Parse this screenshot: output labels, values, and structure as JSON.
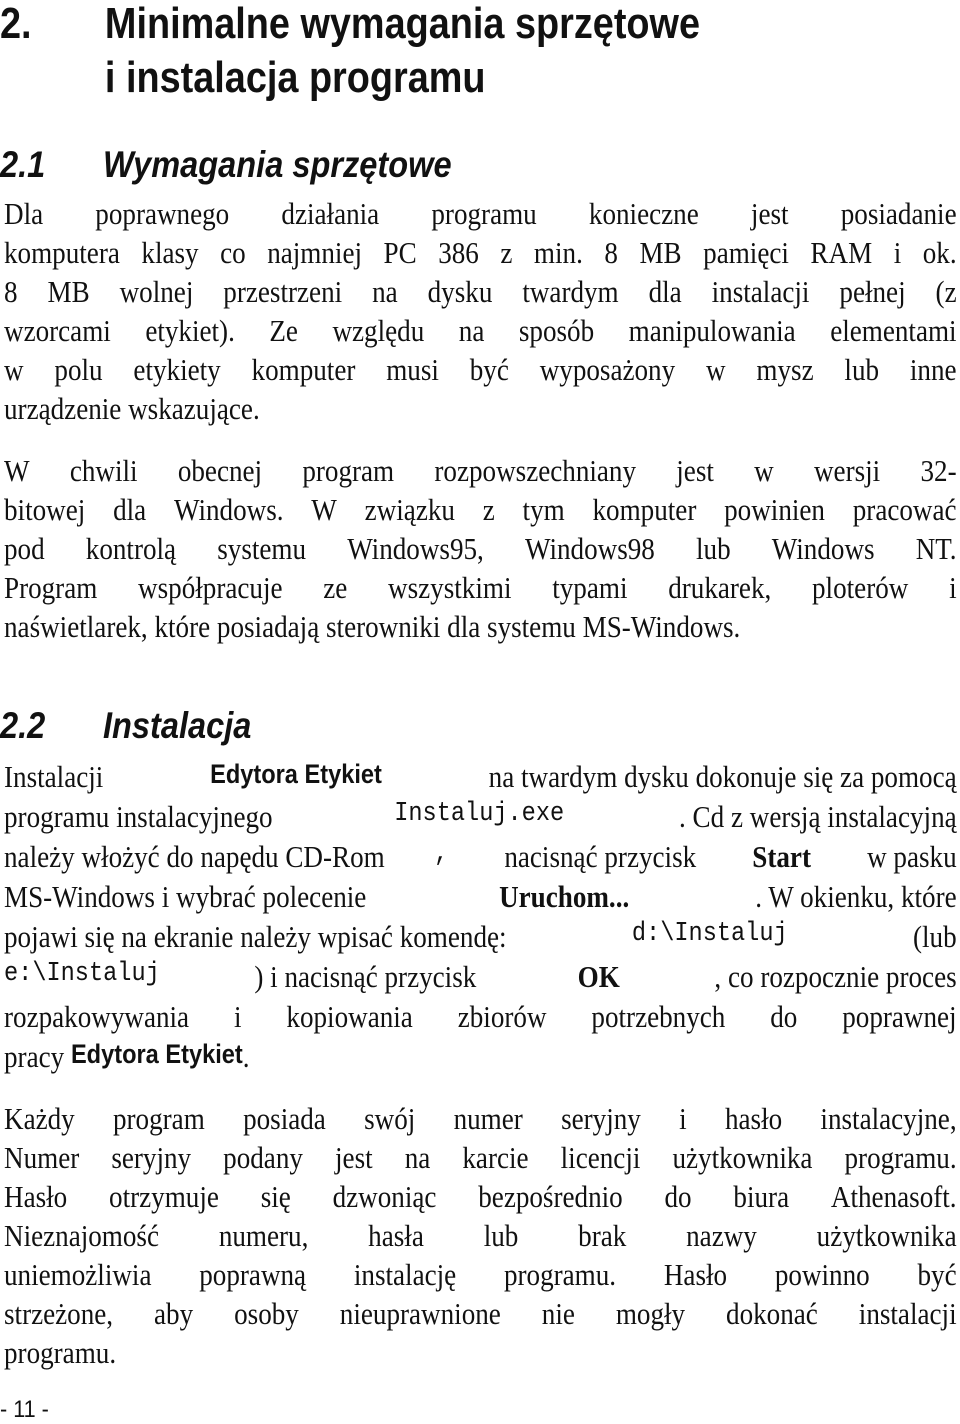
{
  "chapter": {
    "number": "2.",
    "title_line1": "Minimalne wymagania sprzętowe",
    "title_line2": "i instalacja programu"
  },
  "section_1": {
    "number": "2.1",
    "title": "Wymagania sprzętowe",
    "para1": [
      "Dla poprawnego działania programu konieczne jest posiadanie",
      "komputera klasy co najmniej PC 386 z min. 8 MB pamięci RAM i ok.",
      "8 MB wolnej przestrzeni na dysku twardym dla instalacji pełnej (z",
      "wzorcami etykiet). Ze względu na sposób manipulowania elementami",
      "w polu etykiety komputer musi być wyposażony w mysz lub inne",
      "urządzenie wskazujące."
    ],
    "para2": [
      "W chwili obecnej program rozpowszechniany jest w wersji 32-",
      "bitowej dla Windows. W związku z tym komputer powinien pracować",
      "pod kontrolą systemu Windows95, Windows98 lub Windows NT.",
      "Program współpracuje ze wszystkimi typami drukarek, ploterów i",
      "naświetlarek, które posiadają sterowniki dla systemu MS-Windows."
    ]
  },
  "section_2": {
    "number": "2.2",
    "title": "Instalacja",
    "para1": {
      "l1_a": "Instalacji ",
      "l1_b": "Edytora Etykiet",
      "l1_c": " na twardym dysku dokonuje się za pomocą",
      "l2_a": "programu instalacyjnego ",
      "l2_b": "Instaluj.exe",
      "l2_c": ". Cd z wersją instalacyjną",
      "l3_a": "należy włożyć do napędu CD-Rom",
      "l3_b": ",",
      "l3_c": " nacisnąć przycisk ",
      "l3_d": "Start",
      "l3_e": " w pasku",
      "l4_a": "MS-Windows i wybrać polecenie ",
      "l4_b": "Uruchom...",
      "l4_c": ". W okienku, które",
      "l5_a": "pojawi się na ekranie należy wpisać komendę: ",
      "l5_b": "d:\\Instaluj",
      "l5_c": " (lub",
      "l6_a": "e:\\Instaluj",
      "l6_b": ") i nacisnąć przycisk ",
      "l6_c": "OK",
      "l6_d": ", co rozpocznie proces",
      "l7": "rozpakowywania i kopiowania zbiorów potrzebnych do poprawnej",
      "l8_a": "pracy ",
      "l8_b": "Edytora Etykiet",
      "l8_c": "."
    },
    "para2": [
      "Każdy program posiada swój numer seryjny i hasło instalacyjne,",
      "Numer seryjny podany jest na karcie licencji użytkownika programu.",
      "Hasło otrzymuje się dzwoniąc bezpośrednio do biura Athenasoft.",
      "Nieznajomość numeru, hasła lub brak nazwy użytkownika",
      "uniemożliwia poprawną instalację programu. Hasło powinno być",
      "strzeżone, aby osoby nieuprawnione nie mogły dokonać instalacji",
      "programu."
    ]
  },
  "footer": {
    "page_number": "- 11 -"
  }
}
